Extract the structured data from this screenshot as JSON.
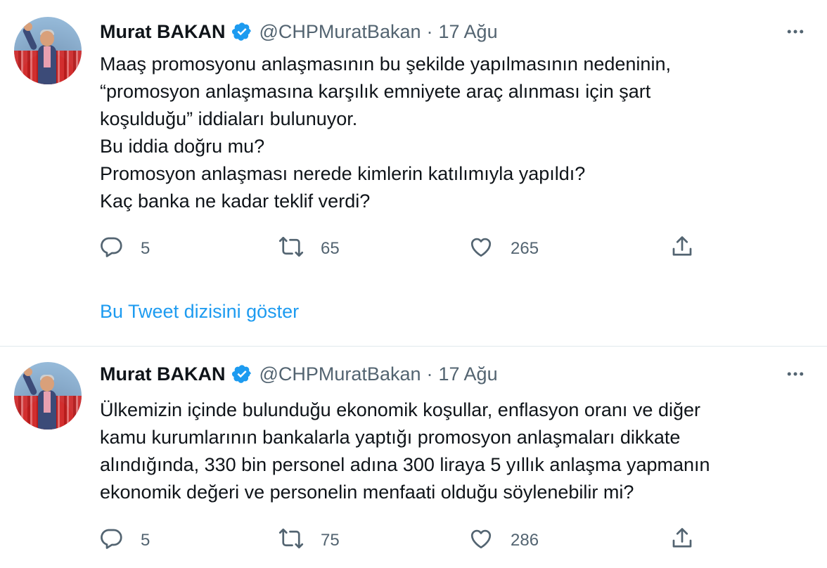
{
  "tweets": [
    {
      "author_name": "Murat BAKAN",
      "handle": "@CHPMuratBakan",
      "separator": "·",
      "date": "17 Ağu",
      "lines": [
        "Maaş promosyonu anlaşmasının bu şekilde yapılmasının nedeninin,",
        "“promosyon anlaşmasına karşılık emniyete araç alınması için şart",
        "koşulduğu” iddiaları bulunuyor.",
        "Bu iddia doğru mu?",
        "Promosyon anlaşması nerede kimlerin katılımıyla yapıldı?",
        "Kaç banka ne kadar teklif verdi?"
      ],
      "reply_count": "5",
      "retweet_count": "65",
      "like_count": "265",
      "show_thread": "Bu Tweet dizisini göster"
    },
    {
      "author_name": "Murat BAKAN",
      "handle": "@CHPMuratBakan",
      "separator": "·",
      "date": "17 Ağu",
      "lines": [
        "Ülkemizin içinde bulunduğu ekonomik koşullar, enflasyon oranı ve diğer",
        "kamu kurumlarının bankalarla yaptığı promosyon anlaşmaları dikkate",
        "alındığında, 330 bin personel adına 300 liraya 5 yıllık anlaşma yapmanın",
        "ekonomik değeri ve personelin menfaati olduğu söylenebilir mi?"
      ],
      "reply_count": "5",
      "retweet_count": "75",
      "like_count": "286"
    }
  ],
  "icons": {
    "verified": "verified-badge-icon",
    "more": "more-dots-icon",
    "reply": "reply-icon",
    "retweet": "retweet-icon",
    "like": "heart-icon",
    "share": "share-icon"
  },
  "colors": {
    "link": "#1d9bf0",
    "secondary_text": "#536471",
    "primary_text": "#0f1419",
    "verified": "#1d9bf0",
    "divider": "#e1e8ed"
  }
}
